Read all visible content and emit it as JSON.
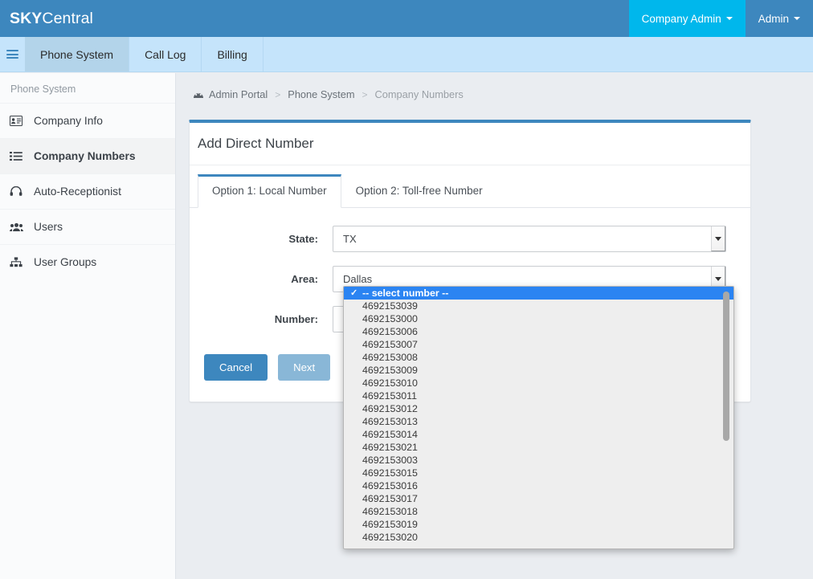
{
  "header": {
    "brand_strong": "SKY",
    "brand_light": "Central",
    "company_admin_label": "Company Admin",
    "admin_label": "Admin"
  },
  "navbar": {
    "menu_icon": "hamburger-icon",
    "tabs": [
      {
        "label": "Phone System",
        "active": true
      },
      {
        "label": "Call Log",
        "active": false
      },
      {
        "label": "Billing",
        "active": false
      }
    ]
  },
  "sidebar": {
    "heading": "Phone System",
    "items": [
      {
        "label": "Company Info",
        "icon": "contact-card-icon",
        "active": false
      },
      {
        "label": "Company Numbers",
        "icon": "list-icon",
        "active": true
      },
      {
        "label": "Auto-Receptionist",
        "icon": "headset-icon",
        "active": false
      },
      {
        "label": "Users",
        "icon": "users-icon",
        "active": false
      },
      {
        "label": "User Groups",
        "icon": "sitemap-icon",
        "active": false
      }
    ]
  },
  "breadcrumb": {
    "icon": "dashboard-icon",
    "items": [
      "Admin Portal",
      "Phone System",
      "Company Numbers"
    ],
    "separator": ">"
  },
  "panel": {
    "title": "Add Direct Number",
    "tabs": [
      {
        "label": "Option 1: Local Number",
        "active": true
      },
      {
        "label": "Option 2: Toll-free Number",
        "active": false
      }
    ],
    "fields": [
      {
        "label": "State:",
        "value": "TX",
        "name": "state"
      },
      {
        "label": "Area:",
        "value": "Dallas",
        "name": "area"
      },
      {
        "label": "Number:",
        "value": "-- select number --",
        "name": "number"
      }
    ],
    "buttons": {
      "cancel": "Cancel",
      "next": "Next"
    }
  },
  "number_dropdown": {
    "open": true,
    "selected": "-- select number --",
    "options": [
      "-- select number --",
      "4692153039",
      "4692153000",
      "4692153006",
      "4692153007",
      "4692153008",
      "4692153009",
      "4692153010",
      "4692153011",
      "4692153012",
      "4692153013",
      "4692153014",
      "4692153021",
      "4692153003",
      "4692153015",
      "4692153016",
      "4692153017",
      "4692153018",
      "4692153019",
      "4692153020"
    ]
  },
  "colors": {
    "header_blue": "#3d87be",
    "accent_cyan": "#00b7ec",
    "nav_blue": "#c5e4fb",
    "nav_active": "#b3d4ea",
    "content_bg": "#eaedf1",
    "highlight_blue": "#2b84f2"
  }
}
